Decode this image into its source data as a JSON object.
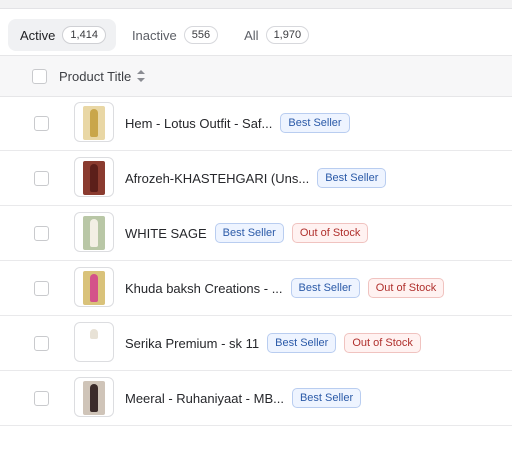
{
  "tabs": [
    {
      "label": "Active",
      "count": "1,414"
    },
    {
      "label": "Inactive",
      "count": "556"
    },
    {
      "label": "All",
      "count": "1,970"
    }
  ],
  "table": {
    "header": {
      "title": "Product Title"
    },
    "rows": [
      {
        "name": "Hem - Lotus Outfit - Saf...",
        "badges": [
          "Best Seller"
        ],
        "thumb": "yellow-outfit-image"
      },
      {
        "name": "Afrozeh-KHASTEHGARI (Uns...",
        "badges": [
          "Best Seller"
        ],
        "thumb": "maroon-outfit-image"
      },
      {
        "name": "WHITE SAGE",
        "badges": [
          "Best Seller",
          "Out of Stock"
        ],
        "thumb": "white-outfit-image"
      },
      {
        "name": "Khuda baksh Creations - ...",
        "badges": [
          "Best Seller",
          "Out of Stock"
        ],
        "thumb": "pink-outfit-image"
      },
      {
        "name": "Serika Premium - sk 11",
        "badges": [
          "Best Seller",
          "Out of Stock"
        ],
        "thumb": "white-outfit-image"
      },
      {
        "name": "Meeral - Ruhaniyaat - MB...",
        "badges": [
          "Best Seller"
        ],
        "thumb": "dark-outfit-image"
      }
    ]
  },
  "colors": {
    "best_seller_text": "#2b5aa8",
    "out_of_stock_text": "#b0302d"
  }
}
